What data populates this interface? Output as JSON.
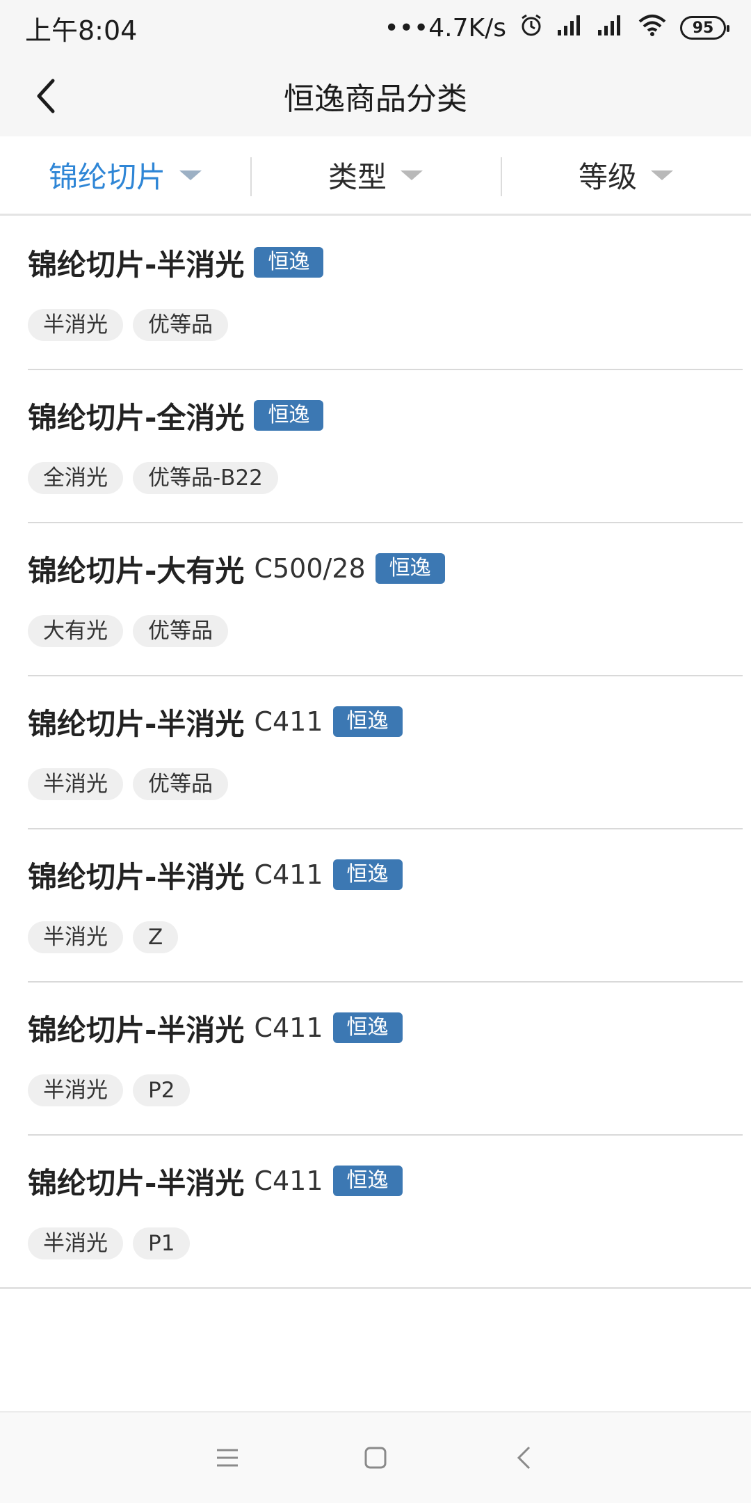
{
  "status_bar": {
    "time": "上午8:04",
    "speed": "•••4.7K/s",
    "battery": "95"
  },
  "nav": {
    "title": "恒逸商品分类"
  },
  "filters": [
    {
      "label": "锦纶切片",
      "active": true
    },
    {
      "label": "类型",
      "active": false
    },
    {
      "label": "等级",
      "active": false
    }
  ],
  "items": [
    {
      "title": "锦纶切片-半消光",
      "model": "",
      "badge": "恒逸",
      "tags": [
        "半消光",
        "优等品"
      ]
    },
    {
      "title": "锦纶切片-全消光",
      "model": "",
      "badge": "恒逸",
      "tags": [
        "全消光",
        "优等品-B22"
      ]
    },
    {
      "title": "锦纶切片-大有光",
      "model": "C500/28",
      "badge": "恒逸",
      "tags": [
        "大有光",
        "优等品"
      ]
    },
    {
      "title": "锦纶切片-半消光",
      "model": "C411",
      "badge": "恒逸",
      "tags": [
        "半消光",
        "优等品"
      ]
    },
    {
      "title": "锦纶切片-半消光",
      "model": "C411",
      "badge": "恒逸",
      "tags": [
        "半消光",
        "Z"
      ]
    },
    {
      "title": "锦纶切片-半消光",
      "model": "C411",
      "badge": "恒逸",
      "tags": [
        "半消光",
        "P2"
      ]
    },
    {
      "title": "锦纶切片-半消光",
      "model": "C411",
      "badge": "恒逸",
      "tags": [
        "半消光",
        "P1"
      ]
    }
  ],
  "colors": {
    "accent": "#2f86d6",
    "badge": "#3c78b3",
    "tag_bg": "#efefef"
  },
  "icons": {
    "back": "chevron-left-icon",
    "alarm": "alarm-icon",
    "signal": "signal-icon",
    "wifi": "wifi-icon",
    "menu": "menu-icon",
    "home": "home-square-icon",
    "sys_back": "back-triangle-icon"
  }
}
